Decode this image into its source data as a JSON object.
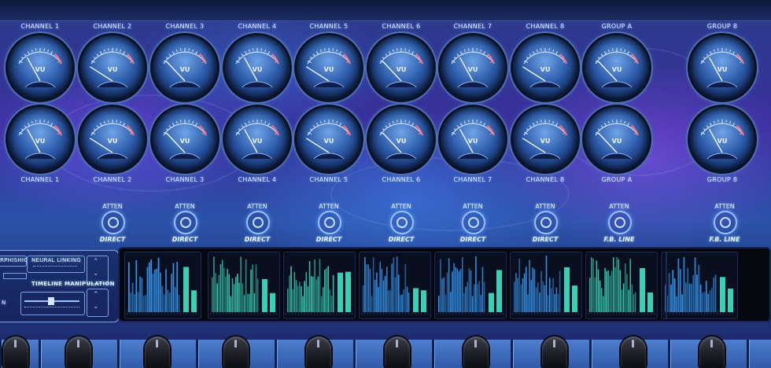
{
  "channels": [
    {
      "name": "CHANNEL 1",
      "switch": null
    },
    {
      "name": "CHANNEL 2",
      "switch": "DIRECT"
    },
    {
      "name": "CHANNEL 3",
      "switch": "DIRECT"
    },
    {
      "name": "CHANNEL 4",
      "switch": "DIRECT"
    },
    {
      "name": "CHANNEL 5",
      "switch": "DIRECT"
    },
    {
      "name": "CHANNEL 6",
      "switch": "DIRECT"
    },
    {
      "name": "CHANNEL 7",
      "switch": "DIRECT"
    },
    {
      "name": "CHANNEL 8",
      "switch": "DIRECT"
    },
    {
      "name": "GROUP A",
      "switch": "F.B. LINE"
    },
    {
      "name": "GROUP 8",
      "switch": "F.B. LINE"
    }
  ],
  "meter_label": "VU",
  "atten_label": "ATTEN",
  "control_panel": {
    "morphic_label": "RPHISHIC",
    "neural_label": "NEURAL LINKING",
    "timeline_label": "TIMELINE MANIPULATION",
    "side_letter": "N"
  },
  "colors": {
    "accent": "#6aa8ff",
    "spectrum_teal": "#3fe0c0",
    "spectrum_blue": "#3aa0ff"
  }
}
